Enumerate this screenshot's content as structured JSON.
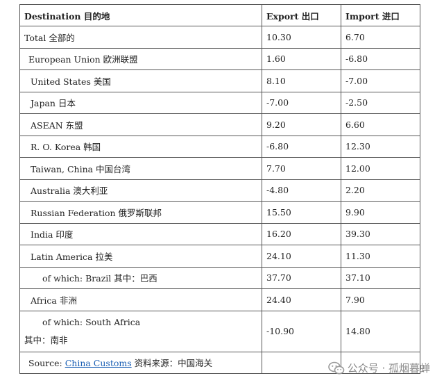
{
  "headers": {
    "destination": "Destination 目的地",
    "export": "Export 出口",
    "import": "Import 进口"
  },
  "rows": [
    {
      "label": "Total 全部的",
      "export": "10.30",
      "import": "6.70"
    },
    {
      "label": "European Union  欧洲联盟",
      "export": "1.60",
      "import": "-6.80"
    },
    {
      "label": "United States  美国",
      "export": "8.10",
      "import": "-7.00"
    },
    {
      "label": "Japan  日本",
      "export": "-7.00",
      "import": "-2.50"
    },
    {
      "label": "ASEAN   东盟",
      "export": "9.20",
      "import": "6.60"
    },
    {
      "label": "R. O. Korea  韩国",
      "export": "-6.80",
      "import": "12.30"
    },
    {
      "label": "Taiwan, China  中国台湾",
      "export": "7.70",
      "import": "12.00"
    },
    {
      "label": "Australia 澳大利亚",
      "export": "-4.80",
      "import": "2.20"
    },
    {
      "label": "Russian Federation  俄罗斯联邦",
      "export": "15.50",
      "import": "9.90"
    },
    {
      "label": "India  印度",
      "export": "16.20",
      "import": "39.30"
    },
    {
      "label": "Latin America  拉美",
      "export": "24.10",
      "import": "11.30"
    },
    {
      "label": "of which: Brazil  其中：巴西",
      "export": "37.70",
      "import": "37.10"
    },
    {
      "label": "Africa 非洲",
      "export": "24.40",
      "import": "7.90"
    }
  ],
  "south_africa": {
    "label_line1": "of which: South Africa",
    "label_line2": "其中：南非",
    "export": "-10.90",
    "import": "14.80"
  },
  "source": {
    "prefix": "Source: ",
    "link": "China Customs",
    "suffix": "  资料来源：中国海关"
  },
  "watermark": {
    "icon": "wechat-icon",
    "text": "公众号 · 孤烟暮蝉"
  }
}
